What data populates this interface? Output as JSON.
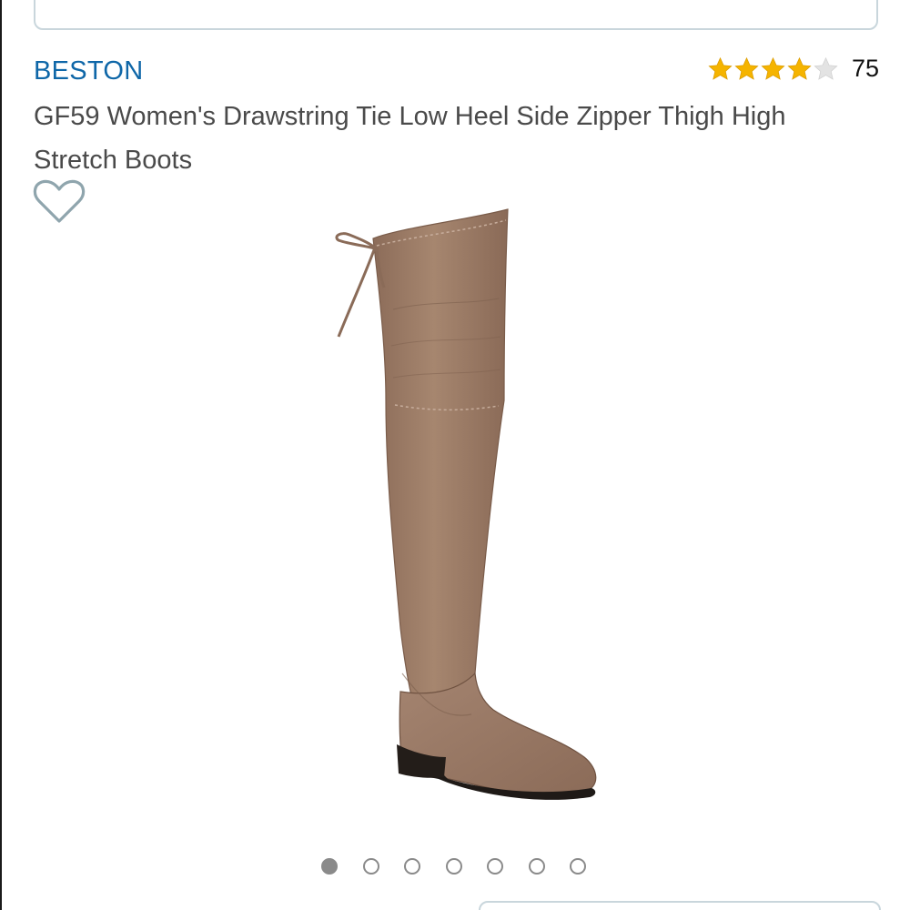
{
  "product": {
    "brand": "BESTON",
    "title": "GF59 Women's Drawstring Tie Low Heel Side Zipper Thigh High Stretch Boots",
    "rating": {
      "stars": 4,
      "max_stars": 5,
      "review_count": "75",
      "filled_color": "#f5b400",
      "empty_color": "#d9d9d9"
    },
    "wishlist_icon": "heart-outline-icon",
    "image_alt": "tan over-the-knee suede boot with drawstring tie"
  },
  "carousel": {
    "total": 7,
    "active_index": 0
  },
  "colors": {
    "brand_link": "#0f67a8",
    "title_text": "#4a4a4a",
    "boot_suede": "#9e7e6a"
  }
}
